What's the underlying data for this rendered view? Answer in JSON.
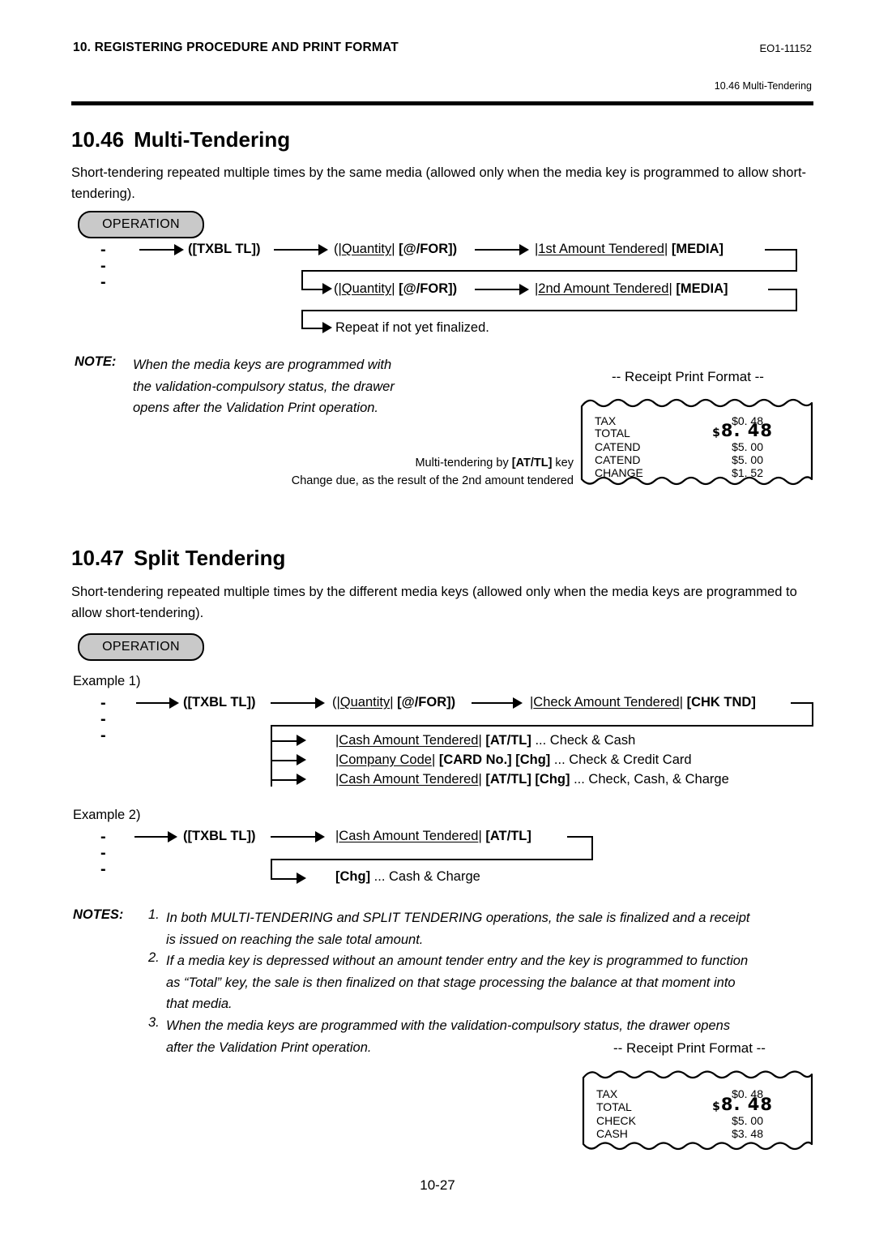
{
  "header": {
    "chapter_title": "10. REGISTERING PROCEDURE AND PRINT FORMAT",
    "doc_code": "EO1-11152",
    "running_head": "10.46 Multi-Tendering"
  },
  "footer": {
    "page_number": "10-27"
  },
  "operation_badge_label": "OPERATION",
  "section_1046": {
    "number": "10.46",
    "title": "Multi-Tendering",
    "intro": "Short-tendering repeated multiple times by the same media (allowed only when the media key is programmed to allow short-tendering).",
    "flow": {
      "dots": "- - -",
      "step_txbl": "([TXBL TL])",
      "step_qty_open": "(|",
      "step_qty_word": "Quantity",
      "step_qty_bar": "|",
      "step_forkey": "[@/FOR])",
      "amount1_bar_l": "|",
      "amount1_word": "1st Amount Tendered",
      "amount1_bar_r": "|",
      "media1": "[MEDIA]",
      "amount2_bar_l": "|",
      "amount2_word": "2nd Amount Tendered",
      "amount2_bar_r": "|",
      "media2": "[MEDIA]",
      "repeat": "Repeat if not yet finalized."
    },
    "note_label": "NOTE:",
    "note_lines": [
      "When the media keys are programmed with",
      "the validation-compulsory status, the drawer",
      "opens after the Validation Print operation."
    ],
    "caption_line1_a": "Multi-tendering by ",
    "caption_line1_key": "[AT/TL]",
    "caption_line1_b": " key",
    "caption_line2": "Change due, as the result of the 2nd amount tendered",
    "receipt_title": "-- Receipt Print Format --",
    "receipt_rows": [
      {
        "label": "TAX",
        "value": "$0. 48",
        "big": false
      },
      {
        "label": "TOTAL",
        "value": "8. 48",
        "big": true,
        "currency": "$"
      },
      {
        "label": "CATEND",
        "value": "$5. 00",
        "big": false
      },
      {
        "label": "CATEND",
        "value": "$5. 00",
        "big": false
      },
      {
        "label": "CHANGE",
        "value": "$1. 52",
        "big": false
      }
    ]
  },
  "section_1047": {
    "number": "10.47",
    "title": "Split Tendering",
    "intro": "Short-tendering repeated multiple times by the different media keys (allowed only when the media keys are programmed to allow short-tendering).",
    "example1_label": "Example 1)",
    "example1": {
      "dots": "- - -",
      "step_txbl": "([TXBL TL])",
      "step_qty_open": "(|",
      "step_qty_word": "Quantity",
      "step_qty_bar": "|",
      "step_forkey": "[@/FOR])",
      "check_bar_l": "|",
      "check_word": "Check Amount Tendered",
      "check_bar_r": "|",
      "chk_tnd_key": "[CHK TND]",
      "branches": [
        {
          "bar_l": "|",
          "word": "Cash Amount Tendered",
          "bar_r": "|",
          "keys": "[AT/TL]",
          "desc": " ... Check & Cash"
        },
        {
          "bar_l": "|",
          "word": "Company Code",
          "bar_r": "|",
          "keys": "[CARD No.] [Chg]",
          "desc": " ... Check & Credit Card"
        },
        {
          "bar_l": "|",
          "word": "Cash Amount Tendered",
          "bar_r": "|",
          "keys": "[AT/TL] [Chg]",
          "desc": " ... Check, Cash, & Charge"
        }
      ]
    },
    "example2_label": "Example 2)",
    "example2": {
      "dots": "- - -",
      "step_txbl": "([TXBL TL])",
      "cash_bar_l": "|",
      "cash_word": "Cash Amount Tendered",
      "cash_bar_r": "|",
      "at_tl_key": "[AT/TL]",
      "branch_key": "[Chg]",
      "branch_desc": " ... Cash & Charge"
    },
    "notes_label": "NOTES:",
    "notes": [
      {
        "num": "1.",
        "lines": [
          "In both MULTI-TENDERING and SPLIT TENDERING operations, the sale is finalized and a receipt",
          "is issued on reaching the sale total amount."
        ]
      },
      {
        "num": "2.",
        "lines": [
          "If a media key is depressed without an amount tender entry and the key is programmed to function",
          "as “Total” key, the sale is then finalized on that stage processing the balance at that moment into",
          "that media."
        ]
      },
      {
        "num": "3.",
        "lines": [
          "When the media keys are programmed with the validation-compulsory status, the drawer opens",
          "after the Validation Print operation."
        ]
      }
    ],
    "receipt_title": "-- Receipt Print Format --",
    "receipt_rows": [
      {
        "label": "TAX",
        "value": "$0. 48",
        "big": false
      },
      {
        "label": "TOTAL",
        "value": "8. 48",
        "big": true,
        "currency": "$"
      },
      {
        "label": "CHECK",
        "value": "$5. 00",
        "big": false
      },
      {
        "label": "CASH",
        "value": "$3. 48",
        "big": false
      }
    ]
  },
  "colors": {
    "ink": "#000000",
    "badge_fill": "#c9c9c9",
    "paper": "#ffffff"
  }
}
